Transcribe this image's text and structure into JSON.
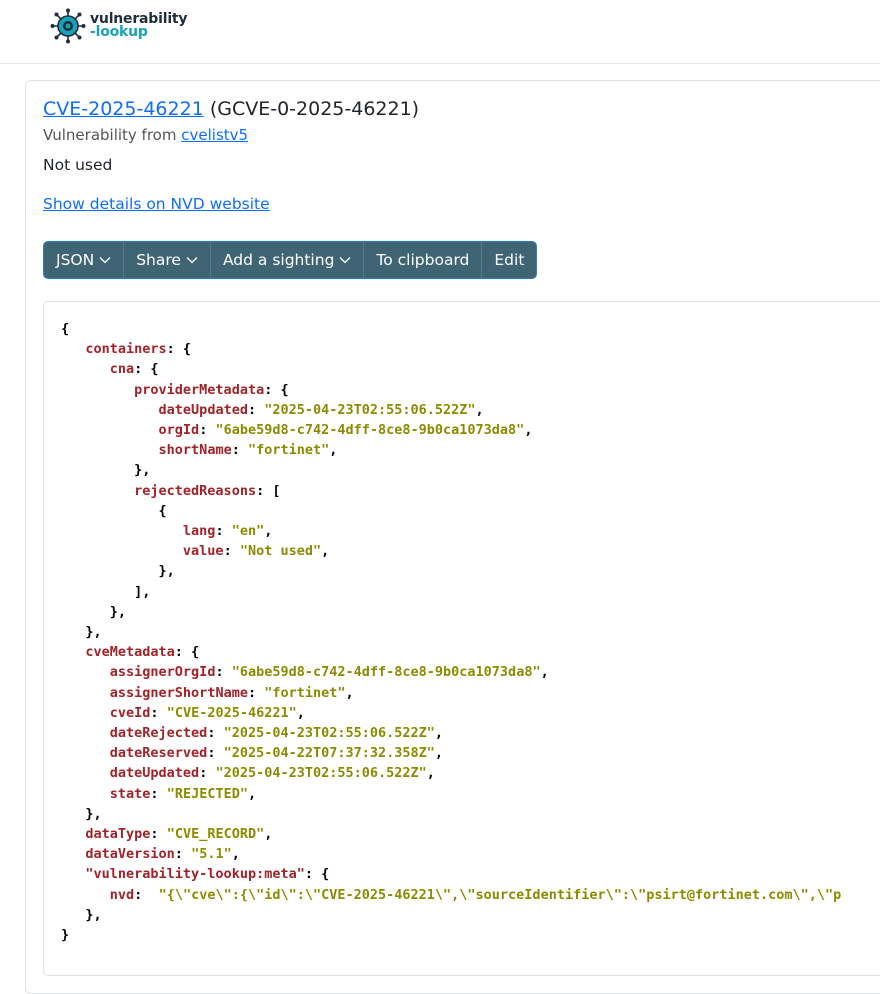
{
  "logo": {
    "word1": "vulnerability",
    "word2": "-lookup"
  },
  "vuln": {
    "cve_id": "CVE-2025-46221",
    "gcve_id": "(GCVE-0-2025-46221)",
    "source_prefix": "Vulnerability from",
    "source": "cvelistv5",
    "description": "Not used",
    "nvd_link": "Show details on NVD website"
  },
  "toolbar": {
    "json": "JSON",
    "share": "Share",
    "sighting": "Add a sighting",
    "clipboard": "To clipboard",
    "edit": "Edit"
  },
  "record": {
    "provider_dateUpdated": "\"2025-04-23T02:55:06.522Z\"",
    "provider_orgId": "\"6abe59d8-c742-4dff-8ce8-9b0ca1073da8\"",
    "provider_shortName": "\"fortinet\"",
    "rejected_lang": "\"en\"",
    "rejected_value": "\"Not used\"",
    "assignerOrgId": "\"6abe59d8-c742-4dff-8ce8-9b0ca1073da8\"",
    "assignerShortName": "\"fortinet\"",
    "cveId": "\"CVE-2025-46221\"",
    "dateRejected": "\"2025-04-23T02:55:06.522Z\"",
    "dateReserved": "\"2025-04-22T07:37:32.358Z\"",
    "dateUpdated": "\"2025-04-23T02:55:06.522Z\"",
    "state": "\"REJECTED\"",
    "dataType": "\"CVE_RECORD\"",
    "dataVersion": "\"5.1\"",
    "nvd": "\"{\\\"cve\\\":{\\\"id\\\":\\\"CVE-2025-46221\\\",\\\"sourceIdentifier\\\":\\\"psirt@fortinet.com\\\",\\\"p"
  }
}
